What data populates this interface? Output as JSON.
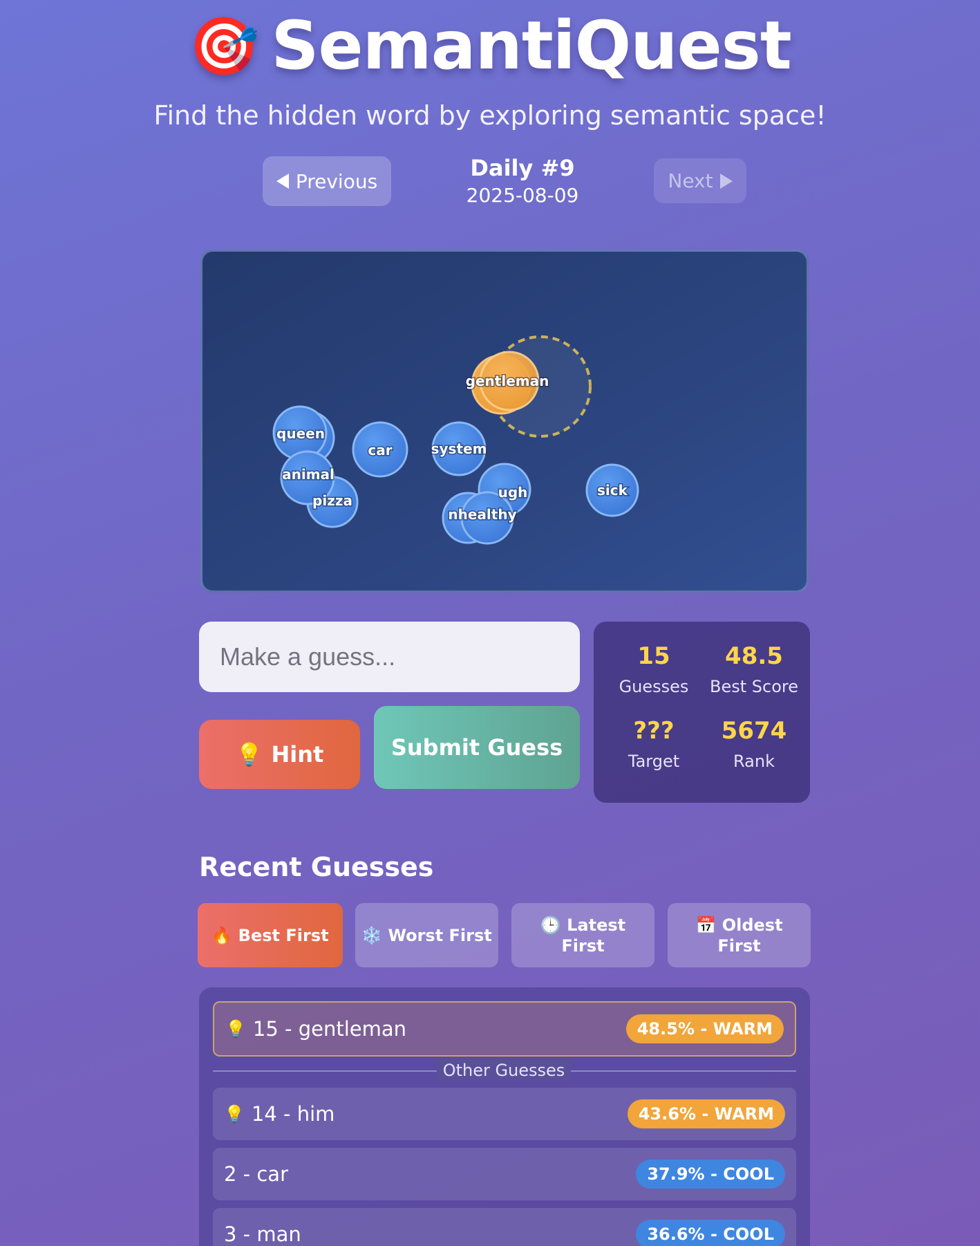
{
  "app": {
    "title": "SemantiQuest",
    "logo_icon": "🎯",
    "subtitle": "Find the hidden word by exploring semantic space!"
  },
  "nav": {
    "previous_label": "Previous",
    "next_label": "Next",
    "daily_label": "Daily #9",
    "date": "2025-08-09"
  },
  "space": {
    "words": [
      "gentleman",
      "queen",
      "car",
      "system",
      "animal",
      "pizza",
      "ugh",
      "nhealthy",
      "sick"
    ]
  },
  "guess": {
    "placeholder": "Make a guess...",
    "hint_label": "Hint",
    "hint_icon": "💡",
    "submit_label": "Submit Guess"
  },
  "stats": {
    "guesses_value": "15",
    "guesses_label": "Guesses",
    "best_value": "48.5",
    "best_label": "Best Score",
    "target_value": "???",
    "target_label": "Target",
    "rank_value": "5674",
    "rank_label": "Rank"
  },
  "recent": {
    "title": "Recent Guesses",
    "sort_buttons": [
      {
        "icon": "🔥",
        "label": "Best First"
      },
      {
        "icon": "❄️",
        "label": "Worst First"
      },
      {
        "icon": "🕒",
        "label": "Latest First"
      },
      {
        "icon": "📅",
        "label": "Oldest First"
      }
    ],
    "divider_label": "Other Guesses",
    "best": {
      "bulb": "💡",
      "text": "15 - gentleman",
      "badge": "48.5% - WARM"
    },
    "rows": [
      {
        "bulb": "💡",
        "text": "14 - him",
        "badge": "43.6% - WARM"
      },
      {
        "bulb": "",
        "text": "2 - car",
        "badge": "37.9% - COOL"
      },
      {
        "bulb": "",
        "text": "3 - man",
        "badge": "36.6% - COOL"
      }
    ]
  },
  "colors": {
    "warm": "#f1a53a",
    "cool": "#3e86e0",
    "stat_value": "#ffd54a"
  }
}
